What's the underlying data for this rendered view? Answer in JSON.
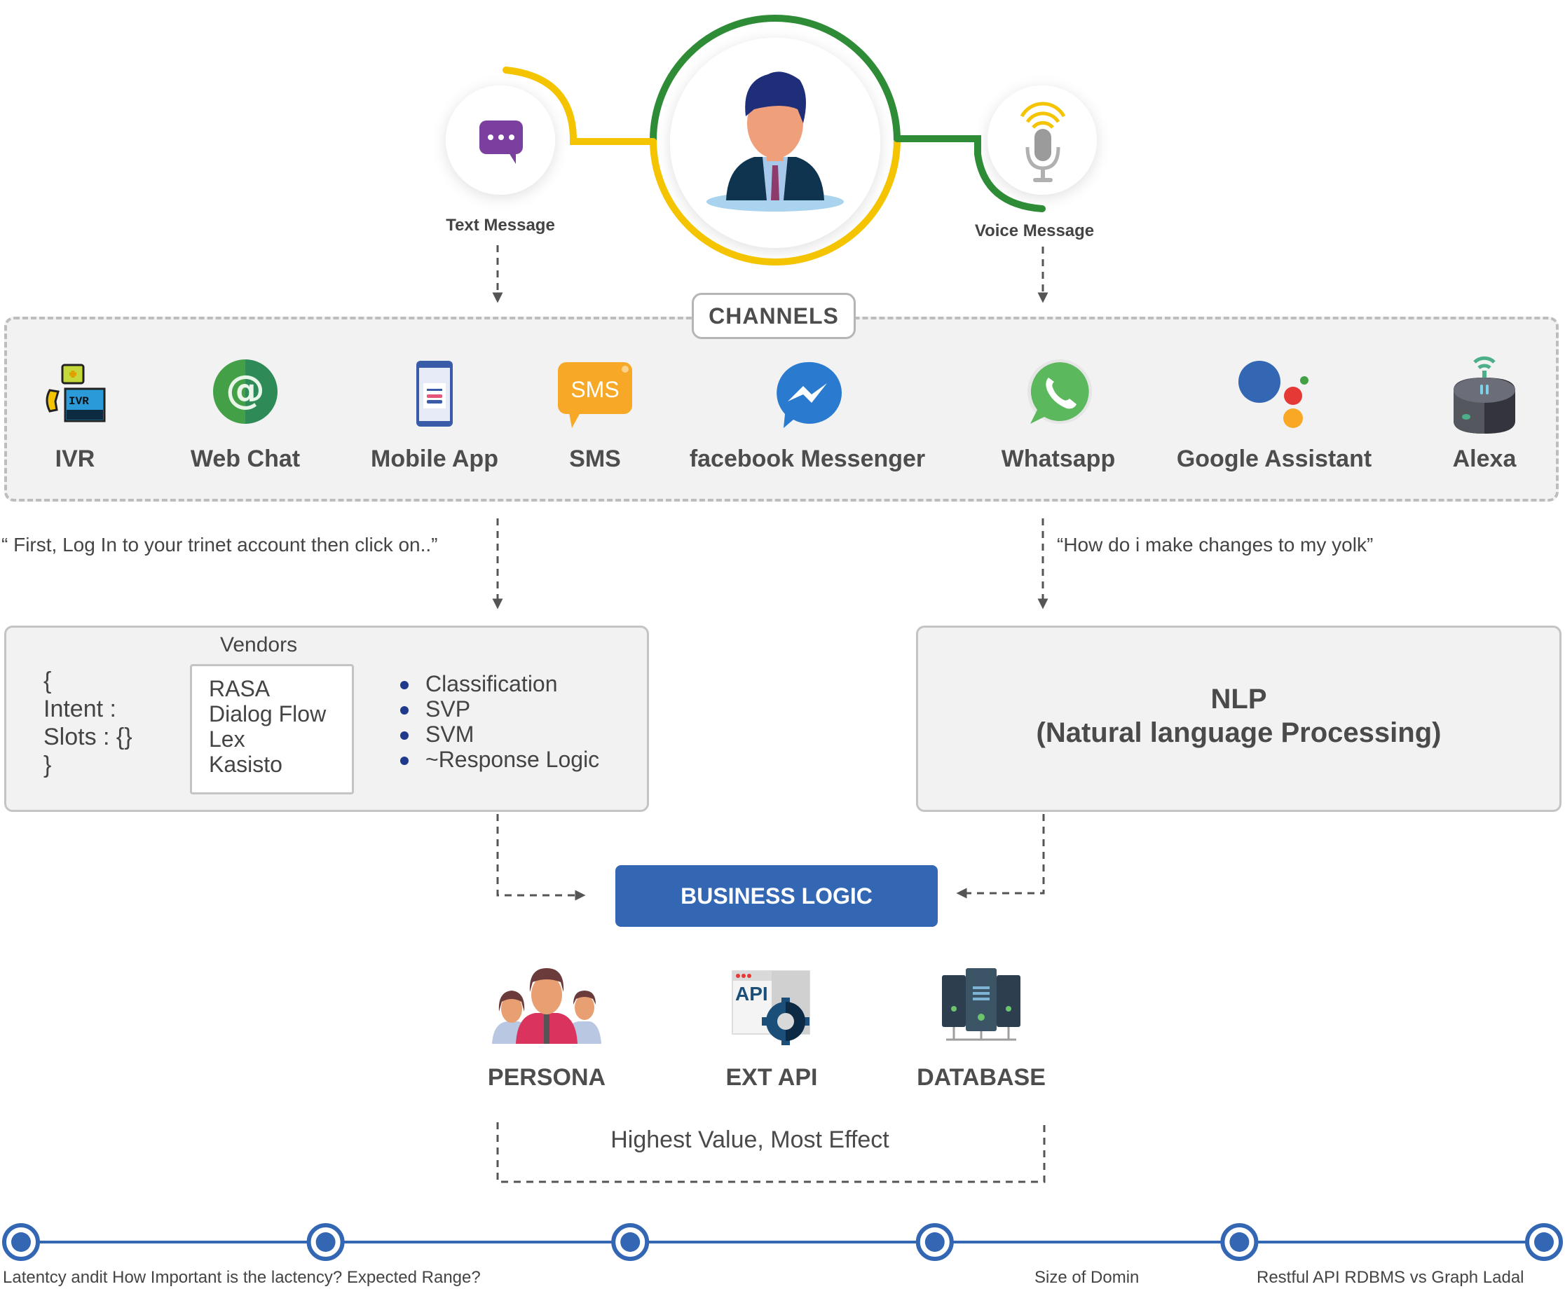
{
  "header": {
    "text_message_label": "Text Message",
    "voice_message_label": "Voice Message",
    "user_icon": "user-avatar-icon",
    "text_icon": "chat-bubble-icon",
    "voice_icon": "microphone-icon"
  },
  "channels": {
    "title": "CHANNELS",
    "items": [
      {
        "label": "IVR",
        "icon": "ivr-icon"
      },
      {
        "label": "Web Chat",
        "icon": "at-sign-chat-icon"
      },
      {
        "label": "Mobile App",
        "icon": "smartphone-icon"
      },
      {
        "label": "SMS",
        "icon": "sms-bubble-icon"
      },
      {
        "label": "facebook Messenger",
        "icon": "messenger-icon"
      },
      {
        "label": "Whatsapp",
        "icon": "whatsapp-icon"
      },
      {
        "label": "Google Assistant",
        "icon": "google-assistant-icon"
      },
      {
        "label": "Alexa",
        "icon": "smart-speaker-icon"
      }
    ]
  },
  "quotes": {
    "left": "“ First, Log In to your trinet account then click on..”",
    "right": "“How do i make changes to my yolk”"
  },
  "vendors_panel": {
    "title": "Vendors",
    "intent_lines": [
      "{",
      "Intent :",
      "Slots : {}",
      "}"
    ],
    "vendors": [
      "RASA",
      "Dialog Flow",
      "Lex",
      "Kasisto"
    ],
    "bullets": [
      "Classification",
      "SVP",
      "SVM",
      "~Response Logic"
    ]
  },
  "nlp_panel": {
    "title": "NLP",
    "subtitle": "(Natural language Processing)"
  },
  "business_logic": {
    "label": "BUSINESS LOGIC"
  },
  "resources": [
    {
      "label": "PERSONA",
      "icon": "people-group-icon"
    },
    {
      "label": "EXT API",
      "icon": "api-gear-icon"
    },
    {
      "label": "DATABASE",
      "icon": "server-database-icon"
    }
  ],
  "summary": {
    "label": "Highest Value, Most Effect"
  },
  "timeline": {
    "node_count": 6,
    "labels": [
      "Latentcy andit  How Important is the lactency? Expected Range?",
      "Size of Domin",
      "Restful API RDBMS vs Graph Ladal"
    ]
  },
  "colors": {
    "accent_blue": "#3467b3",
    "ring_green": "#2e8b36",
    "ring_yellow": "#f5c400",
    "panel_bg": "#f2f2f2",
    "text_dark": "#4a4a4a",
    "bullet": "#1f3a8a"
  }
}
